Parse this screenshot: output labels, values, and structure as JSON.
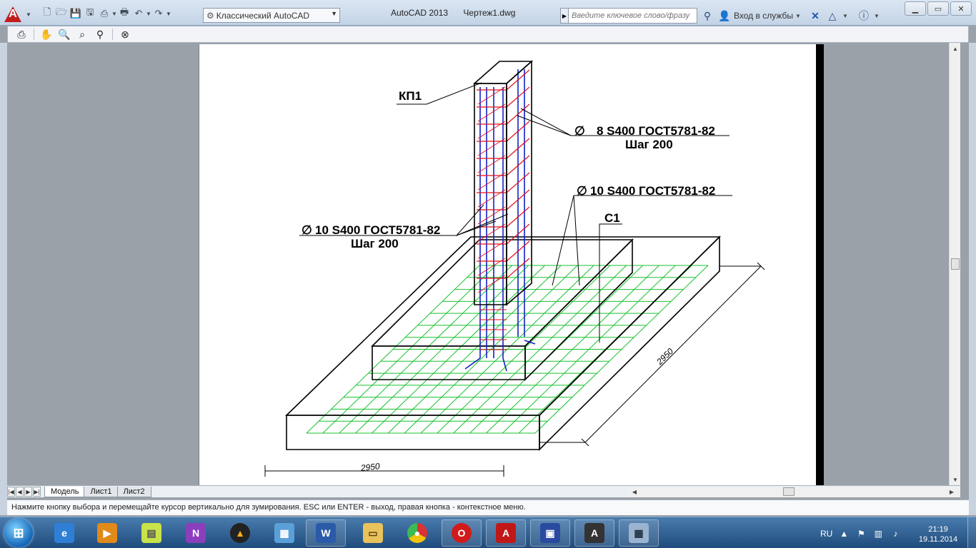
{
  "titlebar": {
    "workspace": "Классический AutoCAD",
    "app_name": "AutoCAD 2013",
    "doc_name": "Чертеж1.dwg",
    "search_placeholder": "Введите ключевое слово/фразу",
    "login": "Вход в службы"
  },
  "tabs": {
    "model": "Модель",
    "sheet1": "Лист1",
    "sheet2": "Лист2"
  },
  "command_line": "Нажмите кнопку выбора и перемещайте курсор вертикально для зумирования. ESC или ENTER - выход, правая кнопка - контекстное меню.",
  "drawing": {
    "label_kp": "КП1",
    "label_rebar8": "8 S400 ГОСТ5781-82",
    "label_step1": "Шаг 200",
    "label_rebar10_right": "10 S400 ГОСТ5781-82",
    "label_c1": "С1",
    "label_rebar10_left": "10 S400 ГОСТ5781-82",
    "label_step2": "Шаг 200",
    "dim_bottom": "2950",
    "dim_right": "2950",
    "diameter_symbol": "∅"
  },
  "colors": {
    "mesh": "#19c12e",
    "rebar_blue": "#1020c8",
    "rebar_red": "#e0101a",
    "lines": "#000000"
  },
  "taskbar": {
    "lang": "RU",
    "time": "21:19",
    "date": "19.11.2014",
    "apps": [
      "ie-icon",
      "media-player-icon",
      "notes-icon",
      "onenote-icon",
      "archicad-icon",
      "control-panel-icon",
      "word-icon",
      "explorer-icon",
      "chrome-icon",
      "opera-icon",
      "pdf-icon",
      "save-icon",
      "autocad-icon",
      "calculator-icon"
    ]
  }
}
